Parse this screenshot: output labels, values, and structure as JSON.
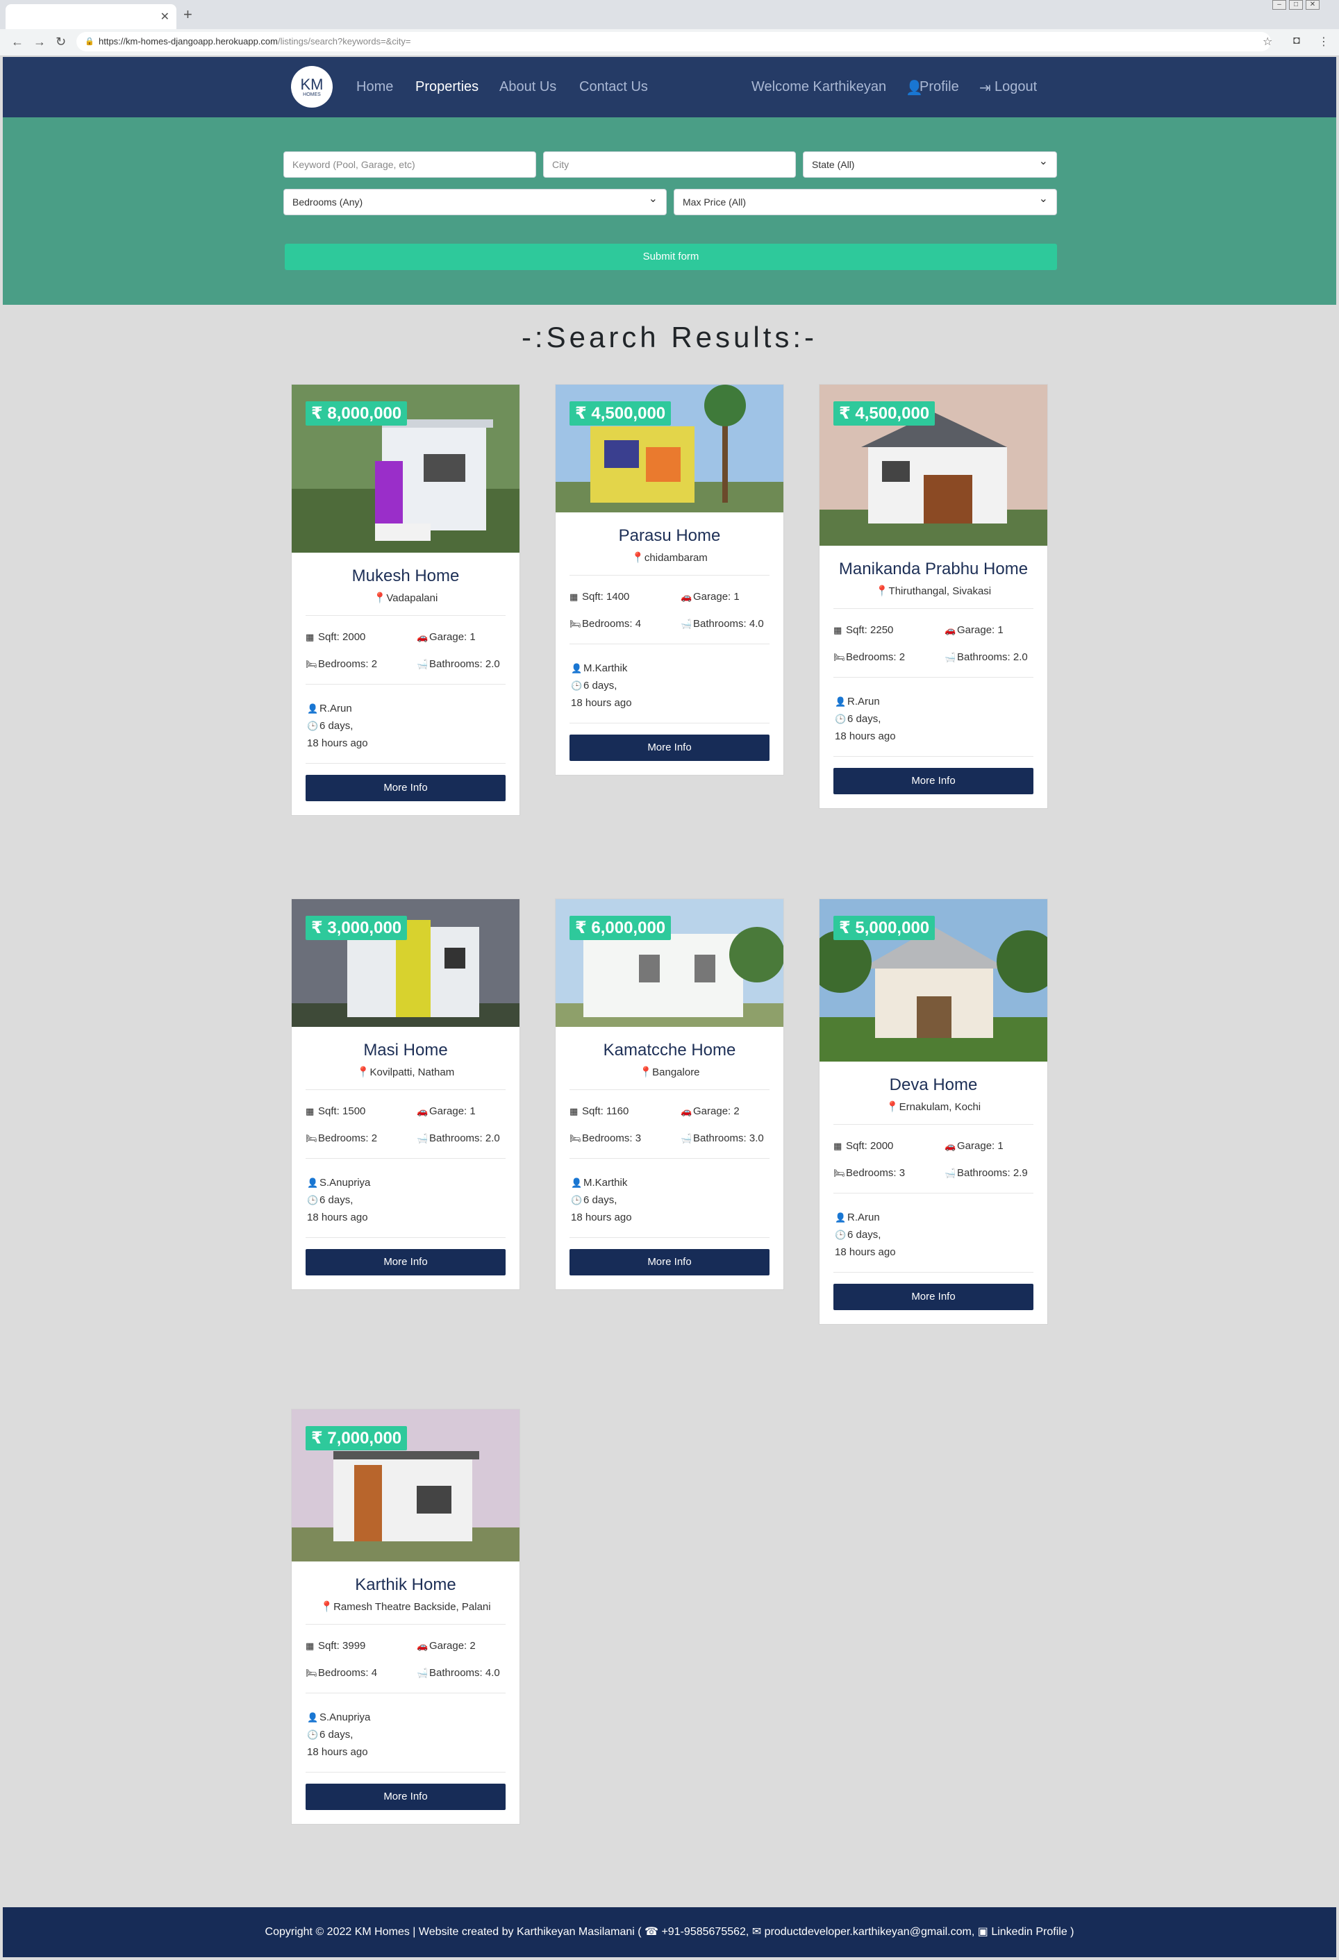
{
  "browser": {
    "url_main": "https://km-homes-djangoapp.herokuapp.com",
    "url_rest": "/listings/search?keywords=&city="
  },
  "nav": {
    "logo_text": "KM",
    "logo_sub": "HOMES",
    "links": [
      "Home",
      "Properties",
      "About Us",
      "Contact Us"
    ],
    "welcome": "Welcome Karthikeyan",
    "profile": "Profile",
    "logout": "Logout"
  },
  "search": {
    "keyword_placeholder": "Keyword (Pool, Garage, etc)",
    "city_placeholder": "City",
    "state_select": "State (All)",
    "bedrooms_select": "Bedrooms (Any)",
    "price_select": "Max Price (All)",
    "submit_label": "Submit form"
  },
  "results_title": "-:Search Results:-",
  "labels": {
    "sqft": "Sqft: ",
    "garage": "Garage: ",
    "bedrooms": "Bedrooms: ",
    "bathrooms": "Bathrooms: ",
    "time_line1": "6 days,",
    "time_line2": "18 hours ago",
    "more_info": "More Info"
  },
  "listings": [
    {
      "price": "₹ 8,000,000",
      "title": "Mukesh Home",
      "location": "Vadapalani",
      "sqft": "2000",
      "garage": "1",
      "bedrooms": "2",
      "bathrooms": "2.0",
      "realtor": "R.Arun"
    },
    {
      "price": "₹ 4,500,000",
      "title": "Parasu Home",
      "location": "chidambaram",
      "sqft": "1400",
      "garage": "1",
      "bedrooms": "4",
      "bathrooms": "4.0",
      "realtor": "M.Karthik"
    },
    {
      "price": "₹ 4,500,000",
      "title": "Manikanda Prabhu Home",
      "location": "Thiruthangal, Sivakasi",
      "sqft": "2250",
      "garage": "1",
      "bedrooms": "2",
      "bathrooms": "2.0",
      "realtor": "R.Arun"
    },
    {
      "price": "₹ 3,000,000",
      "title": "Masi Home",
      "location": "Kovilpatti, Natham",
      "sqft": "1500",
      "garage": "1",
      "bedrooms": "2",
      "bathrooms": "2.0",
      "realtor": "S.Anupriya"
    },
    {
      "price": "₹ 6,000,000",
      "title": "Kamatcche Home",
      "location": "Bangalore",
      "sqft": "1160",
      "garage": "2",
      "bedrooms": "3",
      "bathrooms": "3.0",
      "realtor": "M.Karthik"
    },
    {
      "price": "₹ 5,000,000",
      "title": "Deva Home",
      "location": "Ernakulam, Kochi",
      "sqft": "2000",
      "garage": "1",
      "bedrooms": "3",
      "bathrooms": "2.9",
      "realtor": "R.Arun"
    },
    {
      "price": "₹ 7,000,000",
      "title": "Karthik Home",
      "location": "Ramesh Theatre Backside, Palani",
      "sqft": "3999",
      "garage": "2",
      "bedrooms": "4",
      "bathrooms": "4.0",
      "realtor": "S.Anupriya"
    }
  ],
  "footer": {
    "text": "Copyright © 2022 KM Homes  |  Website created by Karthikeyan Masilamani (",
    "phone": "+91-9585675562,",
    "email": "productdeveloper.karthikeyan@gmail.com,",
    "linkedin": "Linkedin Profile )"
  },
  "colors": {
    "navbar": "#253b66",
    "search_band": "#4a9e86",
    "accent": "#2ec99b",
    "button": "#172c57"
  }
}
